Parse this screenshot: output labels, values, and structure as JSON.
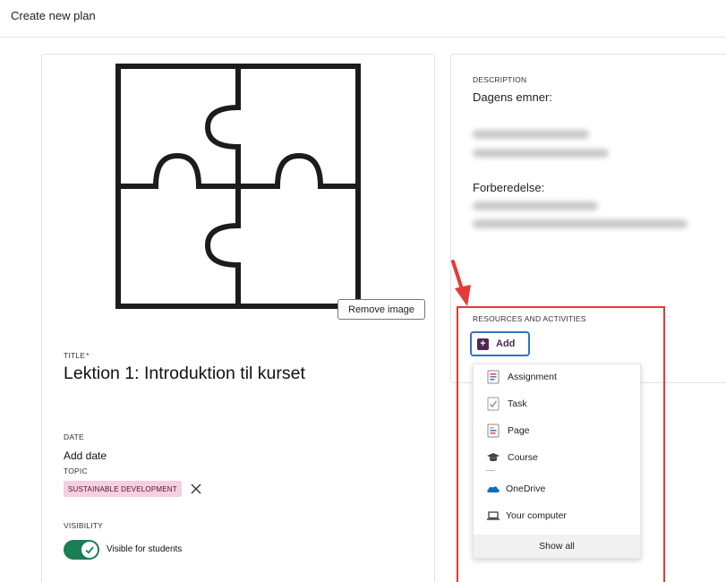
{
  "header": {
    "title": "Create new plan"
  },
  "image": {
    "remove_label": "Remove image"
  },
  "title_field": {
    "label": "TITLE",
    "required_mark": "*",
    "value": "Lektion 1: Introduktion til kurset"
  },
  "date_field": {
    "label": "DATE",
    "value": "Add date"
  },
  "topic_field": {
    "label": "TOPIC",
    "chip": "SUSTAINABLE DEVELOPMENT"
  },
  "visibility": {
    "label": "VISIBILITY",
    "toggle_text": "Visible for students",
    "enabled": true
  },
  "description": {
    "label": "DESCRIPTION",
    "heading1": "Dagens emner:",
    "heading2": "Forberedelse:"
  },
  "resources": {
    "label": "RESOURCES AND ACTIVITIES",
    "add_label": "Add",
    "menu": [
      {
        "label": "Assignment",
        "icon": "assignment-icon"
      },
      {
        "label": "Task",
        "icon": "task-icon"
      },
      {
        "label": "Page",
        "icon": "page-icon"
      },
      {
        "label": "Course",
        "icon": "course-icon"
      },
      {
        "label": "OneDrive",
        "icon": "onedrive-icon"
      },
      {
        "label": "Your computer",
        "icon": "laptop-icon"
      }
    ],
    "show_all": "Show all"
  },
  "colors": {
    "accent_purple": "#4a2b4f",
    "focus_blue": "#2f74c0",
    "toggle_green": "#1a7f55",
    "highlight_red": "#e53935",
    "chip_pink": "#f7cfe0"
  }
}
